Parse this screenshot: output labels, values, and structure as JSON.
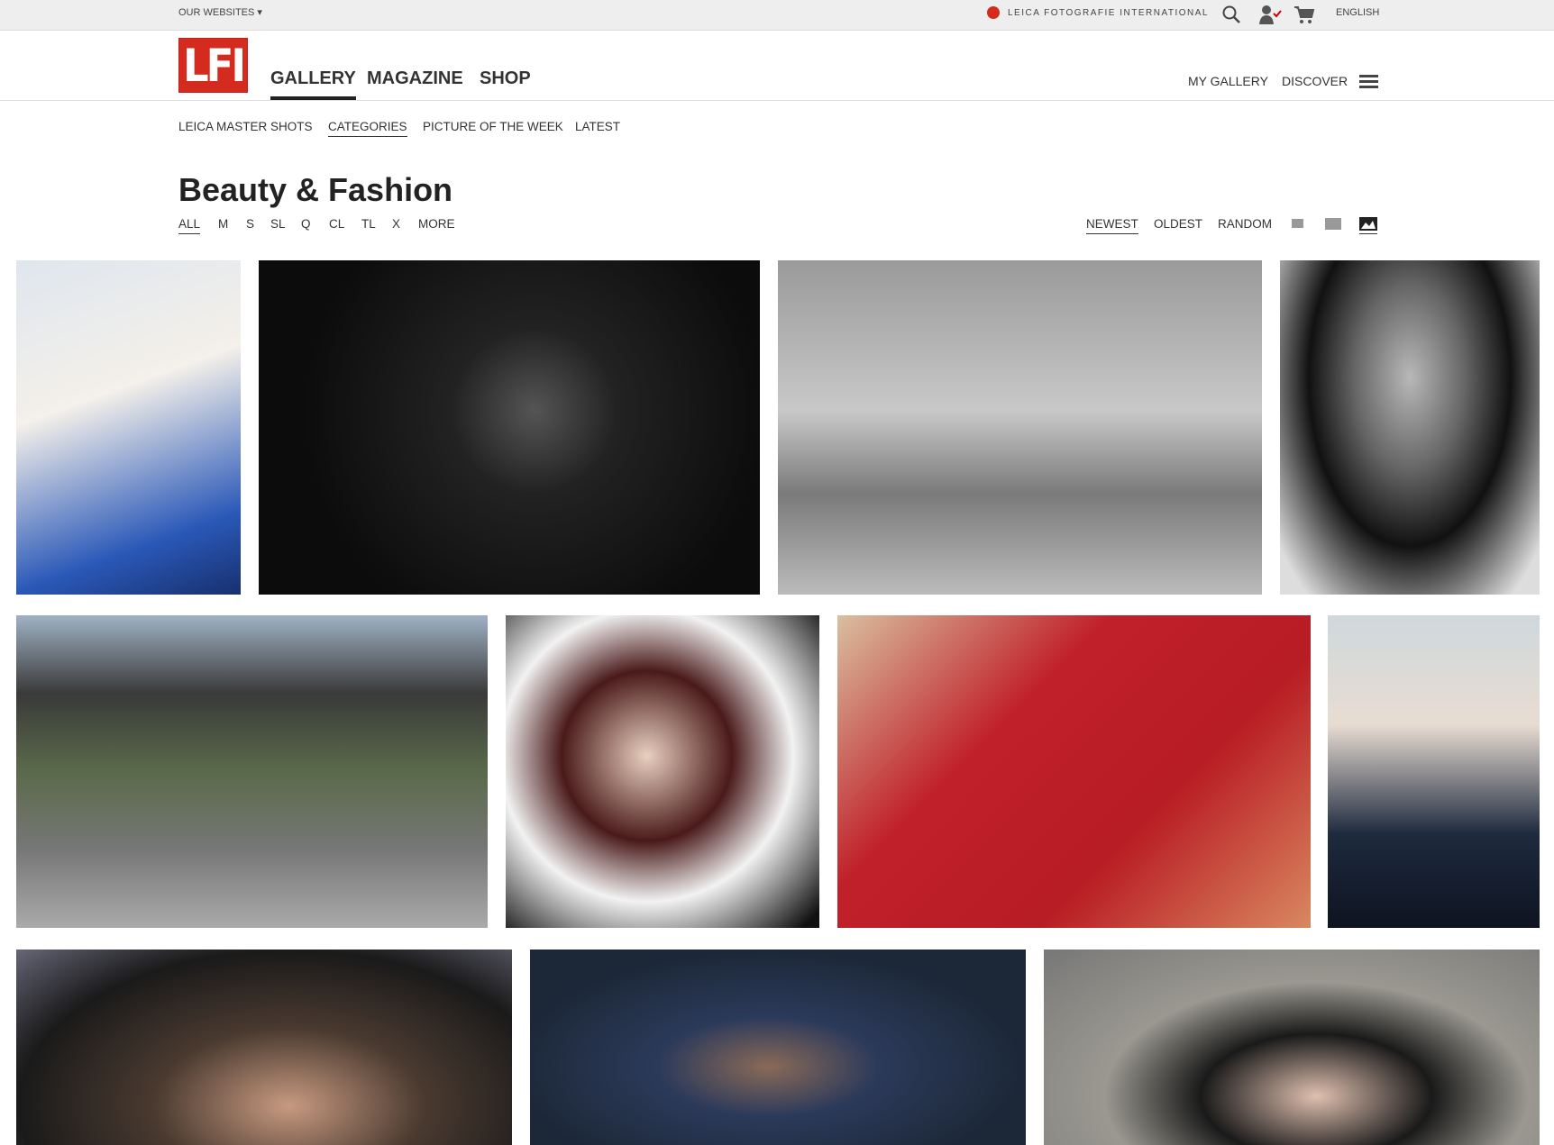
{
  "topbar": {
    "our_websites": "OUR WEBSITES ▾",
    "brand": "LEICA FOTOGRAFIE INTERNATIONAL",
    "language": "ENGLISH",
    "icons": [
      "leica-logo-icon",
      "search-icon",
      "user-check-icon",
      "cart-icon"
    ]
  },
  "header": {
    "logo": "LFI",
    "nav": [
      "GALLERY",
      "MAGAZINE",
      "SHOP"
    ],
    "right_nav": [
      "MY GALLERY",
      "DISCOVER"
    ],
    "active": "GALLERY"
  },
  "subnav": {
    "items": [
      "LEICA MASTER SHOTS",
      "CATEGORIES",
      "PICTURE OF THE WEEK",
      "LATEST"
    ],
    "active": "CATEGORIES"
  },
  "page": {
    "title": "Beauty & Fashion"
  },
  "filters": {
    "cameras": [
      "ALL",
      "M",
      "S",
      "SL",
      "Q",
      "CL",
      "TL",
      "X",
      "MORE"
    ],
    "active_camera": "ALL",
    "sort": [
      "NEWEST",
      "OLDEST",
      "RANDOM"
    ],
    "active_sort": "NEWEST",
    "view_sizes": [
      "small-thumb-icon",
      "medium-thumb-icon",
      "large-thumb-icon"
    ],
    "active_view": "large-thumb-icon"
  },
  "colors": {
    "brand_red": "#d52b1e",
    "topbar_bg": "#eeeeee",
    "check_red": "#cc0000"
  }
}
